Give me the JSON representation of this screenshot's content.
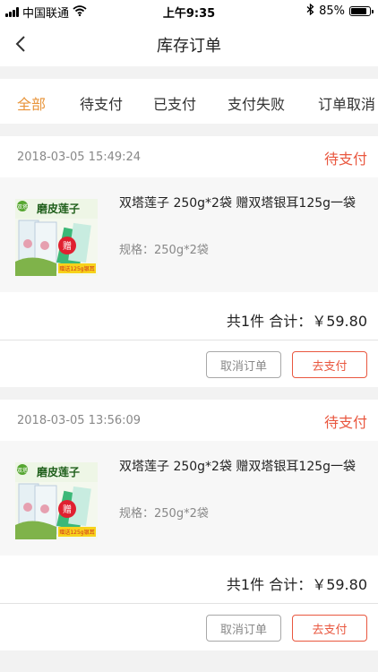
{
  "status_bar": {
    "carrier": "中国联通",
    "time": "上午9:35",
    "battery": "85%",
    "battery_level": 0.85
  },
  "nav": {
    "title": "库存订单"
  },
  "tabs": [
    {
      "label": "全部",
      "active": true
    },
    {
      "label": "待支付"
    },
    {
      "label": "已支付"
    },
    {
      "label": "支付失败"
    },
    {
      "label": "订单取消"
    }
  ],
  "orders": [
    {
      "date": "2018-03-05 15:49:24",
      "status": "待支付",
      "product_name": "双塔莲子 250g*2袋 赠双塔银耳125g一袋",
      "spec": "规格：250g*2袋",
      "total": "共1件 合计：￥59.80",
      "cancel_label": "取消订单",
      "pay_label": "去支付"
    },
    {
      "date": "2018-03-05 13:56:09",
      "status": "待支付",
      "product_name": "双塔莲子 250g*2袋 赠双塔银耳125g一袋",
      "spec": "规格：250g*2袋",
      "total": "共1件 合计：￥59.80",
      "cancel_label": "取消订单",
      "pay_label": "去支付"
    }
  ],
  "product_image": {
    "brand_text": "磨皮莲子",
    "logo_text": "双塔",
    "gift_text": "赠",
    "gift_label": "赠送125g银耳"
  },
  "colors": {
    "accent_orange": "#e8943a",
    "status_red": "#e9573f"
  }
}
